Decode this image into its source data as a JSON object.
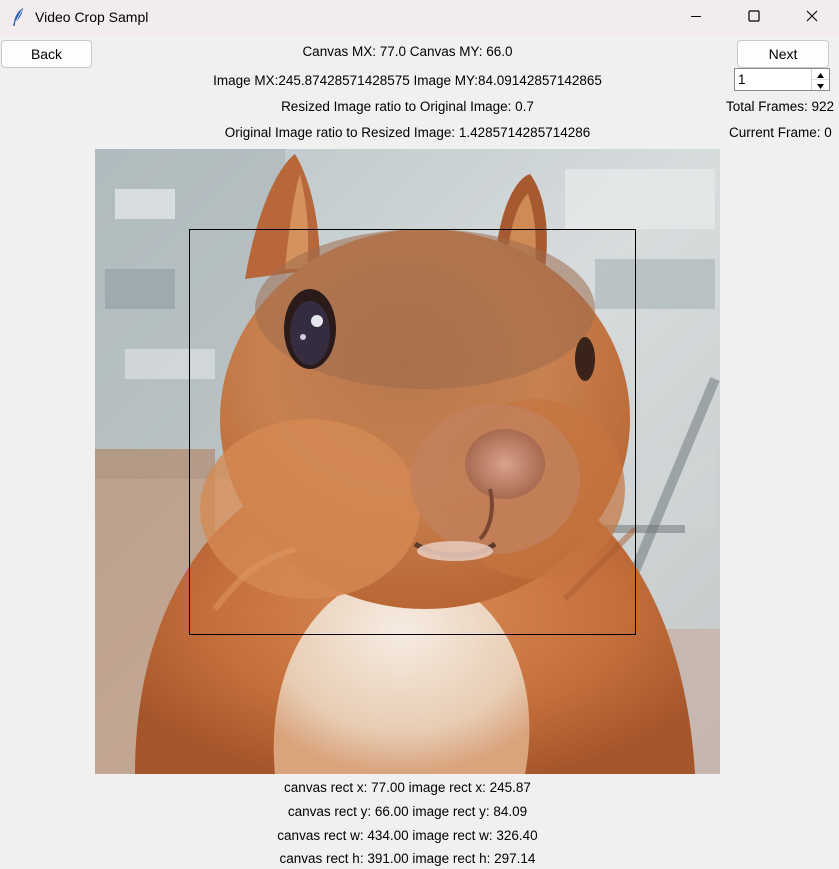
{
  "window": {
    "title": "Video Crop Sampl",
    "controls": {
      "minimize": "minimize-icon",
      "maximize": "maximize-icon",
      "close": "close-icon"
    }
  },
  "toolbar": {
    "back_label": "Back",
    "next_label": "Next"
  },
  "info": {
    "canvas_mouse": "Canvas MX: 77.0 Canvas MY: 66.0",
    "image_mouse": "Image MX:245.87428571428575 Image MY:84.09142857142865",
    "resized_ratio": "Resized Image ratio to Original Image: 0.7",
    "original_ratio": "Original Image ratio to Resized Image: 1.4285714285714286"
  },
  "frames": {
    "step_value": "1",
    "total_label": "Total Frames: 922",
    "current_label": "Current Frame: 0"
  },
  "rect_info": {
    "x": "canvas rect x: 77.00 image rect x: 245.87",
    "y": "canvas rect y: 66.00 image rect y: 84.09",
    "w": "canvas rect w: 434.00 image rect w: 326.40",
    "h": "canvas rect h: 391.00 image rect h: 297.14"
  },
  "colors": {
    "crop_rect": "#000000",
    "button_bg": "#fdfdfd",
    "window_bg": "#f0f0f0"
  }
}
